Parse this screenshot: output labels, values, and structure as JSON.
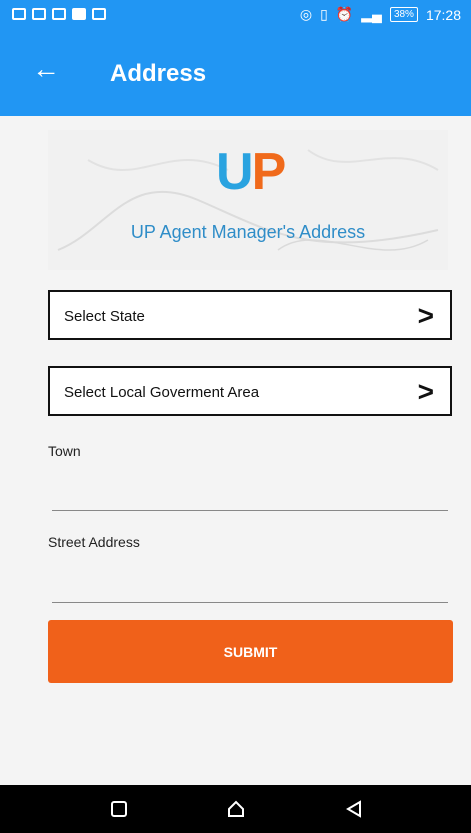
{
  "status_bar": {
    "time": "17:28",
    "battery": "38%"
  },
  "appbar": {
    "title": "Address"
  },
  "hero": {
    "logo_u": "U",
    "logo_p": "P",
    "subtitle": "UP Agent Manager's Address"
  },
  "form": {
    "state_label": "Select State",
    "lga_label": "Select Local Goverment Area",
    "town_label": "Town",
    "town_value": "",
    "street_label": "Street Address",
    "street_value": "",
    "submit_label": "SUBMIT"
  },
  "colors": {
    "appbar": "#2196f3",
    "submit": "#f0611a",
    "logo_u": "#2aa3e0",
    "logo_p": "#f06a1b"
  },
  "icons": [
    "back-arrow-icon",
    "chevron-right-icon",
    "home-icon",
    "recents-icon",
    "back-icon"
  ]
}
